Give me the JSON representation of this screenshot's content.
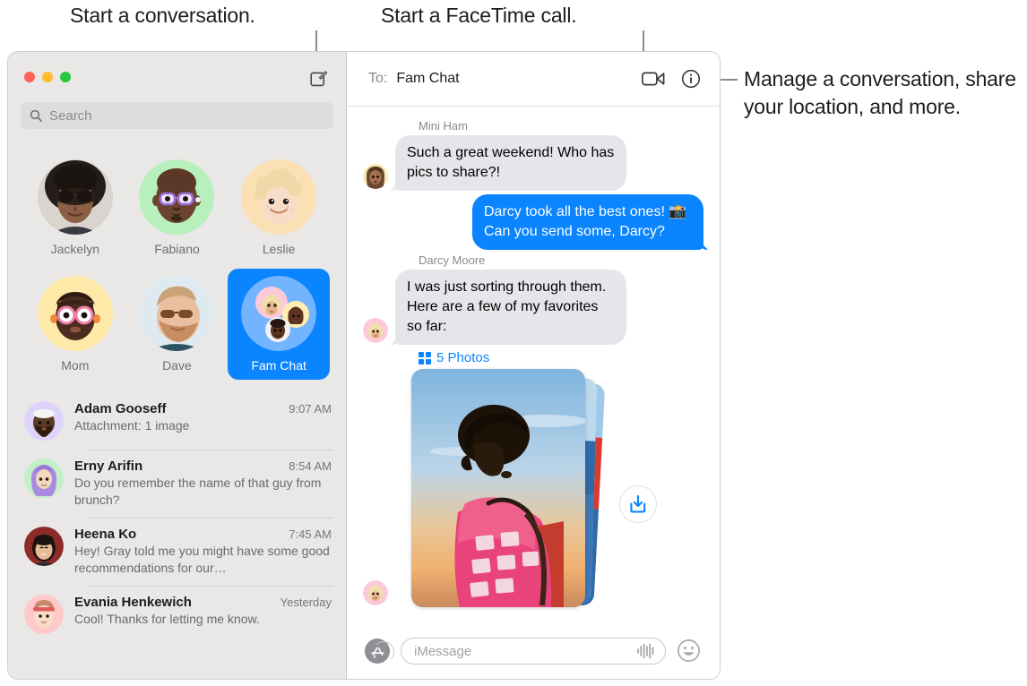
{
  "callouts": {
    "start_conversation": "Start a conversation.",
    "start_facetime": "Start a FaceTime call.",
    "manage": "Manage a conversation, share your location, and more."
  },
  "colors": {
    "accent_blue": "#0A84FF",
    "sidebar_bg": "#E9E8E6",
    "incoming_bubble": "#E6E5EA",
    "outgoing_bubble": "#0A84FF",
    "traffic_red": "#FF6159",
    "traffic_yellow": "#FFBD2E",
    "traffic_green": "#28C840"
  },
  "window": {
    "traffic_lights": [
      "close",
      "minimize",
      "zoom"
    ],
    "compose_icon": "compose-icon"
  },
  "search": {
    "placeholder": "Search",
    "icon": "search-icon"
  },
  "pinned": [
    {
      "label": "Jackelyn",
      "selected": false,
      "avatar": "photo-woman-sunglasses"
    },
    {
      "label": "Fabiano",
      "selected": false,
      "avatar": "memoji-bald-purple-glasses"
    },
    {
      "label": "Leslie",
      "selected": false,
      "avatar": "memoji-blond-curly"
    },
    {
      "label": "Mom",
      "selected": false,
      "avatar": "memoji-pink-glasses"
    },
    {
      "label": "Dave",
      "selected": false,
      "avatar": "photo-man-sunglasses"
    },
    {
      "label": "Fam Chat",
      "selected": true,
      "avatar": "group-three-avatars"
    }
  ],
  "conversations": [
    {
      "name": "Adam Gooseff",
      "time": "9:07 AM",
      "preview": "Attachment: 1 image",
      "avatar": "memoji-beard-cap"
    },
    {
      "name": "Erny Arifin",
      "time": "8:54 AM",
      "preview": "Do you remember the name of that guy from brunch?",
      "avatar": "memoji-hijab"
    },
    {
      "name": "Heena Ko",
      "time": "7:45 AM",
      "preview": "Hey! Gray told me you might have some good recommendations for our…",
      "avatar": "photo-woman-bangs"
    },
    {
      "name": "Evania Henkewich",
      "time": "Yesterday",
      "preview": "Cool! Thanks for letting me know.",
      "avatar": "memoji-headband"
    }
  ],
  "thread": {
    "to_label": "To:",
    "to_value": "Fam Chat",
    "facetime_icon": "video-camera-icon",
    "info_icon": "info-circle-icon",
    "messages": [
      {
        "sender": "Mini Ham",
        "text": "Such a great weekend! Who has pics to share?!",
        "direction": "in",
        "avatar": "memoji-long-hair"
      },
      {
        "sender": "",
        "text": "Darcy took all the best ones! 📸 Can you send some, Darcy?",
        "direction": "out",
        "avatar": ""
      },
      {
        "sender": "Darcy Moore",
        "text": "I was just sorting through them. Here are a few of my favorites so far:",
        "direction": "in",
        "avatar": "memoji-blond-bob"
      }
    ],
    "attachment": {
      "count_label": "5 Photos",
      "grid_icon": "grid-icon",
      "download_icon": "download-icon",
      "avatar": "memoji-blond-bob"
    }
  },
  "composer": {
    "apps_icon": "app-store-icon",
    "placeholder": "iMessage",
    "audio_icon": "audio-waveform-icon",
    "emoji_icon": "emoji-smiley-icon"
  }
}
